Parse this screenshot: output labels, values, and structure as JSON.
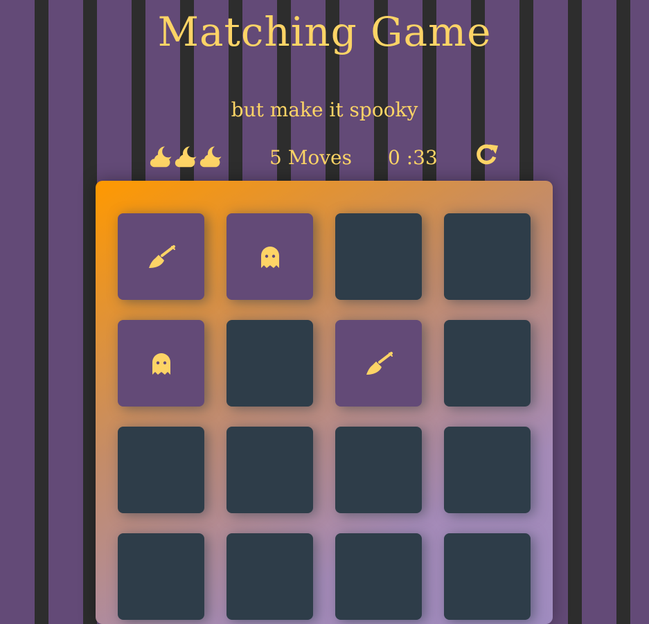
{
  "header": {
    "title": "Matching Game",
    "subtitle": "but make it spooky"
  },
  "score_panel": {
    "stars": [
      "moon-cloud-icon",
      "moon-cloud-icon",
      "moon-cloud-icon"
    ],
    "moves_text": "5 Moves",
    "timer_text": "0 :33",
    "restart_icon": "restart-icon"
  },
  "colors": {
    "accent": "#fdd466",
    "card_closed": "#2e3d49",
    "card_open": "#634a77",
    "stripe_purple": "#634a77",
    "stripe_dark": "#2d2d2d"
  },
  "deck": {
    "cards": [
      {
        "state": "open",
        "icon": "broom-icon"
      },
      {
        "state": "open",
        "icon": "ghost-icon"
      },
      {
        "state": "closed",
        "icon": ""
      },
      {
        "state": "closed",
        "icon": ""
      },
      {
        "state": "open",
        "icon": "ghost-icon"
      },
      {
        "state": "closed",
        "icon": ""
      },
      {
        "state": "open",
        "icon": "broom-icon"
      },
      {
        "state": "closed",
        "icon": ""
      },
      {
        "state": "closed",
        "icon": ""
      },
      {
        "state": "closed",
        "icon": ""
      },
      {
        "state": "closed",
        "icon": ""
      },
      {
        "state": "closed",
        "icon": ""
      },
      {
        "state": "closed",
        "icon": ""
      },
      {
        "state": "closed",
        "icon": ""
      },
      {
        "state": "closed",
        "icon": ""
      },
      {
        "state": "closed",
        "icon": ""
      }
    ]
  }
}
